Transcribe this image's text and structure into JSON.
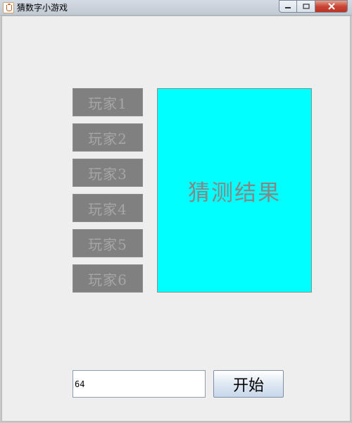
{
  "window": {
    "title": "猜数字小游戏",
    "icon": "java-cup-icon",
    "controls": {
      "minimize": "minimize-icon",
      "maximize": "maximize-icon",
      "close": "close-icon"
    }
  },
  "players": [
    {
      "label": "玩家1"
    },
    {
      "label": "玩家2"
    },
    {
      "label": "玩家3"
    },
    {
      "label": "玩家4"
    },
    {
      "label": "玩家5"
    },
    {
      "label": "玩家6"
    }
  ],
  "result": {
    "label": "猜测结果",
    "background": "#00ffff"
  },
  "input": {
    "value": "64"
  },
  "start_button": {
    "label": "开始"
  }
}
